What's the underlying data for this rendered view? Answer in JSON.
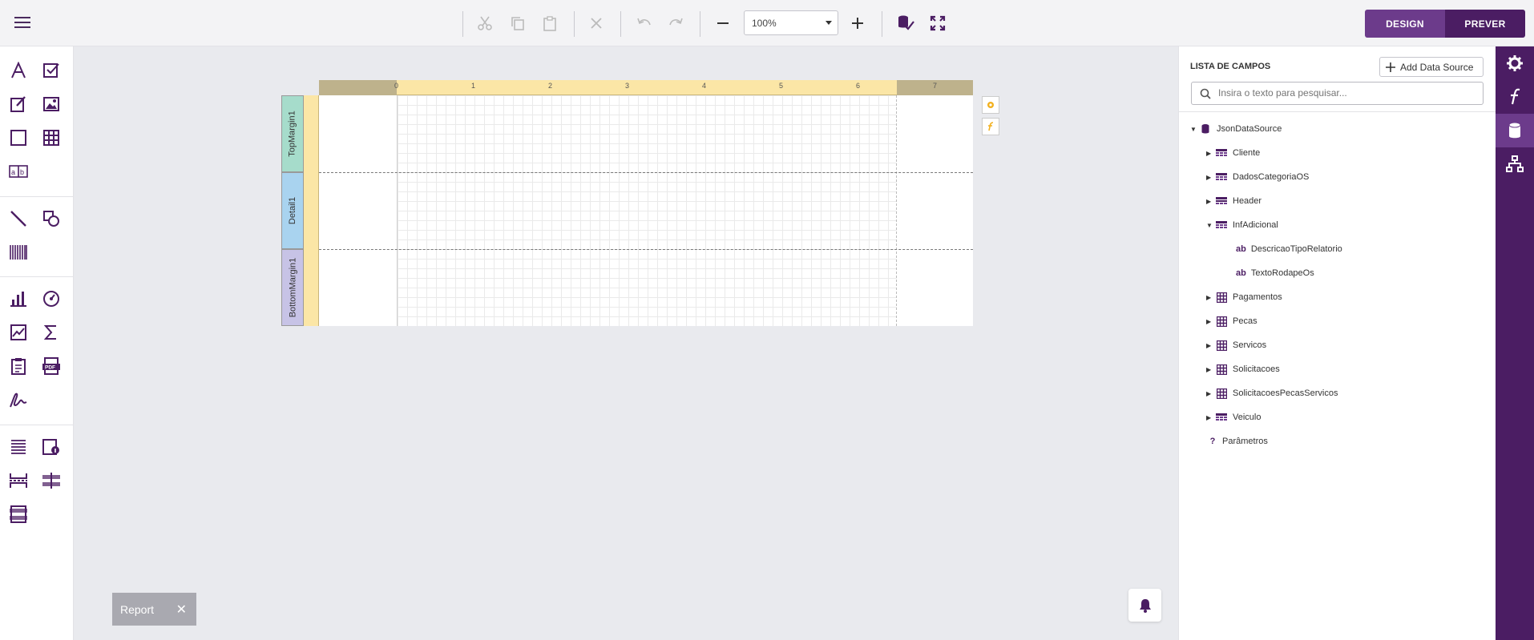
{
  "toolbar": {
    "zoom_value": "100%",
    "design_label": "DESIGN",
    "preview_label": "PREVER"
  },
  "report": {
    "bands": [
      "TopMargin1",
      "Detail1",
      "BottomMargin1"
    ],
    "ruler_numbers": [
      "0",
      "1",
      "2",
      "3",
      "4",
      "5",
      "6",
      "7"
    ]
  },
  "report_tab": {
    "label": "Report"
  },
  "fields_panel": {
    "title": "LISTA DE CAMPOS",
    "add_data_source": "Add Data Source",
    "search_placeholder": "Insira o texto para pesquisar...",
    "tree": {
      "root": "JsonDataSource",
      "items": [
        {
          "label": "Cliente",
          "icon": "table-list-icon"
        },
        {
          "label": "DadosCategoriaOS",
          "icon": "table-list-icon"
        },
        {
          "label": "Header",
          "icon": "table-row-icon"
        },
        {
          "label": "InfAdicional",
          "icon": "table-list-icon"
        },
        {
          "label": "DescricaoTipoRelatorio",
          "icon": "string-field-icon"
        },
        {
          "label": "TextoRodapeOs",
          "icon": "string-field-icon"
        },
        {
          "label": "Pagamentos",
          "icon": "table-grid-icon"
        },
        {
          "label": "Pecas",
          "icon": "table-grid-icon"
        },
        {
          "label": "Servicos",
          "icon": "table-grid-icon"
        },
        {
          "label": "Solicitacoes",
          "icon": "table-grid-icon"
        },
        {
          "label": "SolicitacoesPecasServicos",
          "icon": "table-grid-icon"
        },
        {
          "label": "Veiculo",
          "icon": "table-list-icon"
        }
      ],
      "parameters": "Parâmetros"
    }
  },
  "colors": {
    "brand": "#4b1d63",
    "brand_light": "#6c3b8b",
    "ruler": "#fbe6a6"
  }
}
